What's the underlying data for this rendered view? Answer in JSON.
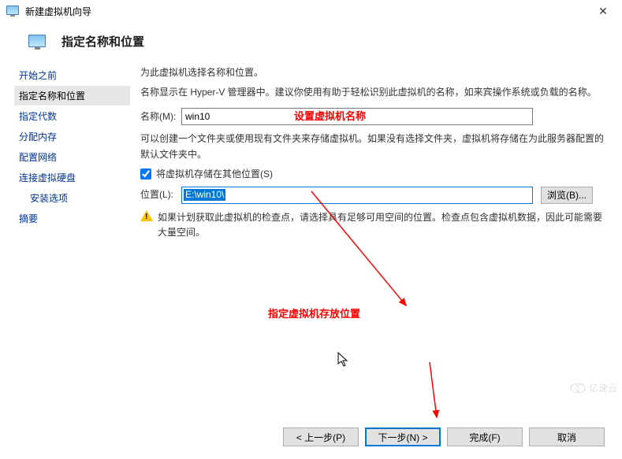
{
  "window": {
    "title": "新建虚拟机向导"
  },
  "header": {
    "heading": "指定名称和位置"
  },
  "sidebar": {
    "steps": [
      {
        "label": "开始之前"
      },
      {
        "label": "指定名称和位置"
      },
      {
        "label": "指定代数"
      },
      {
        "label": "分配内存"
      },
      {
        "label": "配置网络"
      },
      {
        "label": "连接虚拟硬盘"
      },
      {
        "label": "安装选项"
      },
      {
        "label": "摘要"
      }
    ],
    "current_index": 1
  },
  "main": {
    "intro": "为此虚拟机选择名称和位置。",
    "sub": "名称显示在 Hyper-V 管理器中。建议你使用有助于轻松识别此虚拟机的名称，如来宾操作系统或负载的名称。",
    "name_label": "名称(M):",
    "name_value": "win10",
    "red_annotation_name": "设置虚拟机名称",
    "hint": "可以创建一个文件夹或使用现有文件夹来存储虚拟机。如果没有选择文件夹，虚拟机将存储在为此服务器配置的默认文件夹中。",
    "checkbox_label": "将虚拟机存储在其他位置(S)",
    "checkbox_checked": true,
    "location_label": "位置(L):",
    "location_value": "E:\\win10\\",
    "browse_label": "浏览(B)...",
    "warning_text": "如果计划获取此虚拟机的检查点，请选择具有足够可用空间的位置。检查点包含虚拟机数据，因此可能需要大量空间。",
    "red_annotation_location": "指定虚拟机存放位置"
  },
  "buttons": {
    "prev": "< 上一步(P)",
    "next": "下一步(N) >",
    "finish": "完成(F)",
    "cancel": "取消"
  },
  "watermark": "亿速云"
}
